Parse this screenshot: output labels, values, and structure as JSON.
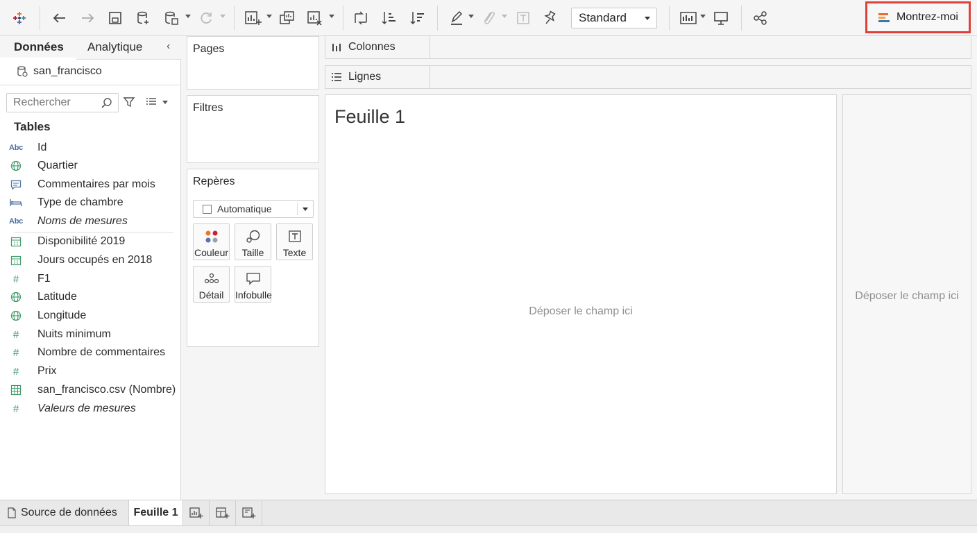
{
  "toolbar": {
    "style_select": "Standard",
    "show_me_label": "Montrez-moi",
    "show_me_bar_colors": [
      "#e76b2c",
      "#f2a54a",
      "#3b76af"
    ]
  },
  "data_pane": {
    "tabs": [
      {
        "label": "Données"
      },
      {
        "label": "Analytique"
      }
    ],
    "datasource": "san_francisco",
    "search_placeholder": "Rechercher",
    "tables_heading": "Tables",
    "dimensions": [
      {
        "icon": "abc-icon",
        "label": "Id"
      },
      {
        "icon": "globe-icon",
        "label": "Quartier"
      },
      {
        "icon": "comment-icon",
        "label": "Commentaires par mois"
      },
      {
        "icon": "bed-icon",
        "label": "Type de chambre"
      },
      {
        "icon": "abc-icon",
        "label": "Noms de mesures"
      }
    ],
    "measures": [
      {
        "icon": "calendar-icon",
        "label": "Disponibilité 2019"
      },
      {
        "icon": "calendar-icon",
        "label": "Jours occupés en 2018"
      },
      {
        "icon": "number-icon",
        "label": "F1"
      },
      {
        "icon": "globe-icon",
        "label": "Latitude"
      },
      {
        "icon": "globe-icon",
        "label": "Longitude"
      },
      {
        "icon": "number-icon",
        "label": "Nuits minimum"
      },
      {
        "icon": "number-icon",
        "label": "Nombre de commentaires"
      },
      {
        "icon": "number-icon",
        "label": "Prix"
      },
      {
        "icon": "table-icon",
        "label": "san_francisco.csv (Nombre)"
      },
      {
        "icon": "number-icon",
        "label": "Valeurs de mesures"
      }
    ],
    "abc_glyph": "Abc",
    "number_glyph": "#"
  },
  "cards": {
    "pages": "Pages",
    "filters": "Filtres",
    "marks": "Repères",
    "mark_type": "Automatique",
    "mark_buttons": [
      "Couleur",
      "Taille",
      "Texte",
      "Détail",
      "Infobulle"
    ]
  },
  "shelves": {
    "columns": "Colonnes",
    "rows": "Lignes"
  },
  "view": {
    "sheet_title": "Feuille 1",
    "drop_field_main": "Déposer le champ ici",
    "drop_field_right": "Déposer le champ ici"
  },
  "sheet_tabs": {
    "source": "Source de données",
    "active_sheet": "Feuille 1"
  },
  "colors": {
    "highlight_border": "#e0403a",
    "dimension_blue": "#4a6fa0",
    "measure_green": "#3e9a6a"
  }
}
